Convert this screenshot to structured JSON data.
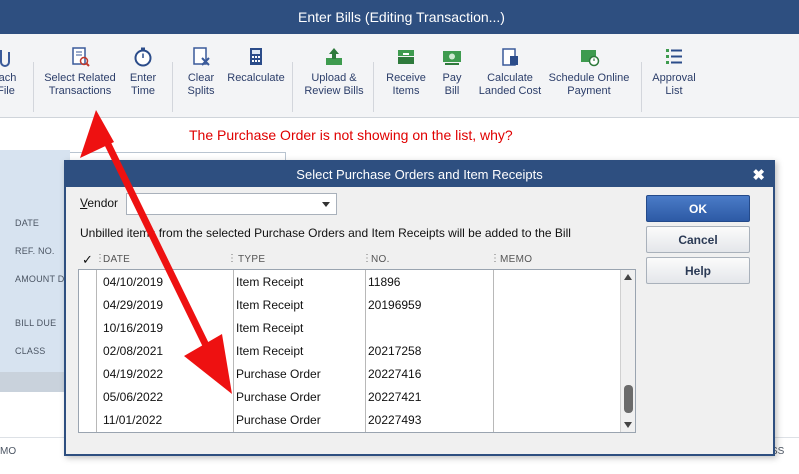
{
  "window": {
    "title": "Enter Bills (Editing Transaction...)"
  },
  "toolbar": {
    "items": [
      {
        "label": "tach\nFile",
        "icon": "paperclip-icon"
      },
      {
        "label": "Select Related\nTransactions",
        "icon": "document-search-icon"
      },
      {
        "label": "Enter\nTime",
        "icon": "stopwatch-icon"
      },
      {
        "label": "Clear\nSplits",
        "icon": "clear-splits-icon"
      },
      {
        "label": "Recalculate",
        "icon": "calculator-icon"
      },
      {
        "label": "Upload &\nReview Bills",
        "icon": "upload-icon"
      },
      {
        "label": "Receive\nItems",
        "icon": "receive-items-icon"
      },
      {
        "label": "Pay\nBill",
        "icon": "pay-bill-icon"
      },
      {
        "label": "Calculate\nLanded Cost",
        "icon": "landed-cost-icon"
      },
      {
        "label": "Schedule Online\nPayment",
        "icon": "schedule-payment-icon"
      },
      {
        "label": "Approval\nList",
        "icon": "approval-list-icon"
      }
    ]
  },
  "annotation": {
    "text": "The Purchase Order is not showing on the list, why?"
  },
  "form": {
    "labels": [
      "DATE",
      "REF. NO.",
      "AMOUNT D",
      "BILL DUE",
      "CLASS"
    ],
    "bottom_left": "MO",
    "bottom_right": "SS"
  },
  "dialog": {
    "title": "Select Purchase Orders and Item Receipts",
    "close": "✖",
    "vendor_label_first": "V",
    "vendor_label_rest": "endor",
    "vendor_value": "",
    "info": "Unbilled items from the selected Purchase Orders and Item Receipts will be added to the Bill",
    "buttons": {
      "ok": "OK",
      "cancel": "Cancel",
      "help": "Help"
    },
    "columns": {
      "check": "✓",
      "date": "DATE",
      "type": "TYPE",
      "no": "NO.",
      "memo": "MEMO"
    },
    "rows": [
      {
        "date": "04/10/2019",
        "type": "Item Receipt",
        "no": "11896",
        "memo": ""
      },
      {
        "date": "04/29/2019",
        "type": "Item Receipt",
        "no": "20196959",
        "memo": ""
      },
      {
        "date": "10/16/2019",
        "type": "Item Receipt",
        "no": "",
        "memo": ""
      },
      {
        "date": "02/08/2021",
        "type": "Item Receipt",
        "no": "20217258",
        "memo": ""
      },
      {
        "date": "04/19/2022",
        "type": "Purchase Order",
        "no": "20227416",
        "memo": ""
      },
      {
        "date": "05/06/2022",
        "type": "Purchase Order",
        "no": "20227421",
        "memo": ""
      },
      {
        "date": "11/01/2022",
        "type": "Purchase Order",
        "no": "20227493",
        "memo": ""
      }
    ]
  },
  "colors": {
    "titlebar": "#2e4f80",
    "annotation": "#e00000",
    "arrow": "#ee1111"
  }
}
